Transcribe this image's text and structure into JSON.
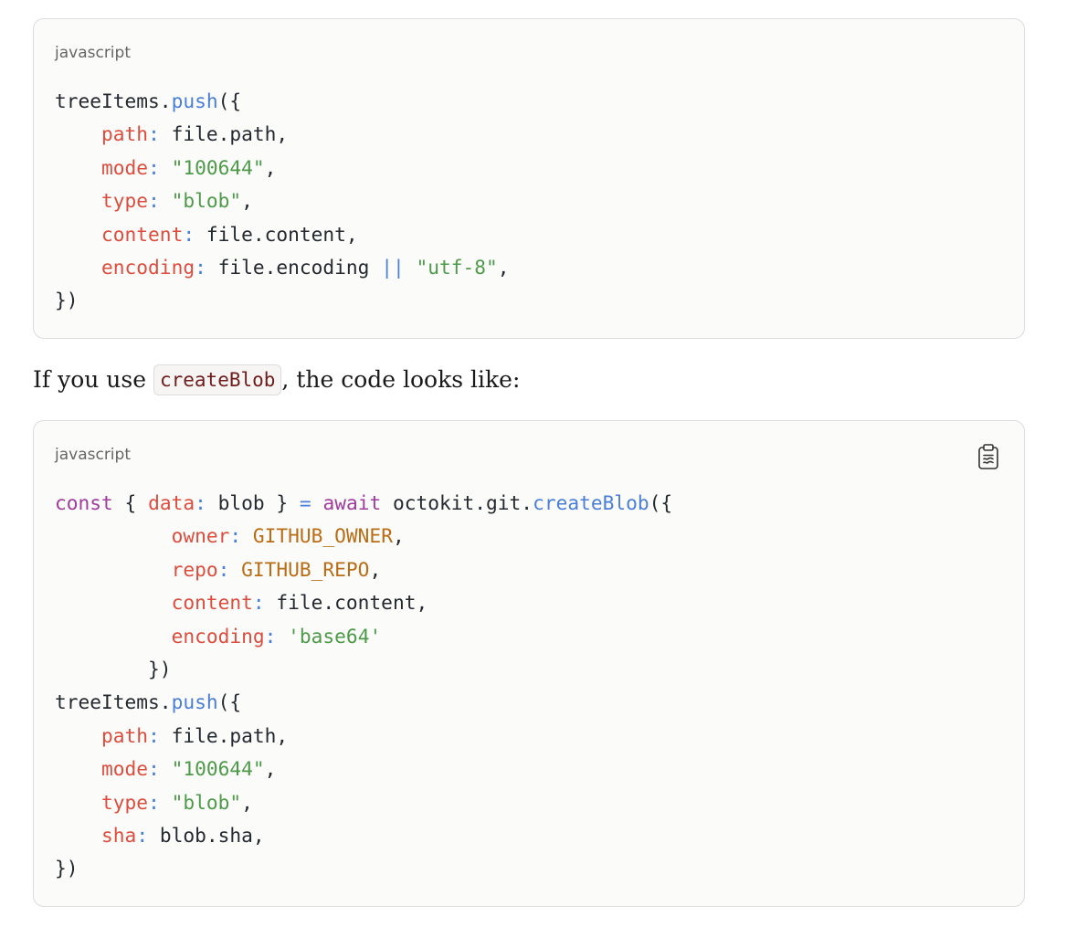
{
  "blocks": [
    {
      "language": "javascript",
      "lines": [
        [
          {
            "t": "treeItems.",
            "c": "plain"
          },
          {
            "t": "push",
            "c": "fn"
          },
          {
            "t": "({",
            "c": "plain"
          }
        ],
        [
          {
            "t": "    ",
            "c": "plain"
          },
          {
            "t": "path",
            "c": "prop"
          },
          {
            "t": ":",
            "c": "op"
          },
          {
            "t": " file.path,",
            "c": "plain"
          }
        ],
        [
          {
            "t": "    ",
            "c": "plain"
          },
          {
            "t": "mode",
            "c": "prop"
          },
          {
            "t": ":",
            "c": "op"
          },
          {
            "t": " ",
            "c": "plain"
          },
          {
            "t": "\"100644\"",
            "c": "str"
          },
          {
            "t": ",",
            "c": "plain"
          }
        ],
        [
          {
            "t": "    ",
            "c": "plain"
          },
          {
            "t": "type",
            "c": "prop"
          },
          {
            "t": ":",
            "c": "op"
          },
          {
            "t": " ",
            "c": "plain"
          },
          {
            "t": "\"blob\"",
            "c": "str"
          },
          {
            "t": ",",
            "c": "plain"
          }
        ],
        [
          {
            "t": "    ",
            "c": "plain"
          },
          {
            "t": "content",
            "c": "prop"
          },
          {
            "t": ":",
            "c": "op"
          },
          {
            "t": " file.content,",
            "c": "plain"
          }
        ],
        [
          {
            "t": "    ",
            "c": "plain"
          },
          {
            "t": "encoding",
            "c": "prop"
          },
          {
            "t": ":",
            "c": "op"
          },
          {
            "t": " file.encoding ",
            "c": "plain"
          },
          {
            "t": "||",
            "c": "op"
          },
          {
            "t": " ",
            "c": "plain"
          },
          {
            "t": "\"utf-8\"",
            "c": "str"
          },
          {
            "t": ",",
            "c": "plain"
          }
        ],
        [
          {
            "t": "})",
            "c": "plain"
          }
        ]
      ]
    },
    {
      "language": "javascript",
      "copy_icon": "clipboard-icon",
      "lines": [
        [
          {
            "t": "const",
            "c": "kw"
          },
          {
            "t": " { ",
            "c": "plain"
          },
          {
            "t": "data",
            "c": "prop"
          },
          {
            "t": ":",
            "c": "op"
          },
          {
            "t": " blob } ",
            "c": "plain"
          },
          {
            "t": "=",
            "c": "op"
          },
          {
            "t": " ",
            "c": "plain"
          },
          {
            "t": "await",
            "c": "kw"
          },
          {
            "t": " octokit.git.",
            "c": "plain"
          },
          {
            "t": "createBlob",
            "c": "fn"
          },
          {
            "t": "({",
            "c": "plain"
          }
        ],
        [
          {
            "t": "          ",
            "c": "plain"
          },
          {
            "t": "owner",
            "c": "prop"
          },
          {
            "t": ":",
            "c": "op"
          },
          {
            "t": " ",
            "c": "plain"
          },
          {
            "t": "GITHUB_OWNER",
            "c": "const"
          },
          {
            "t": ",",
            "c": "plain"
          }
        ],
        [
          {
            "t": "          ",
            "c": "plain"
          },
          {
            "t": "repo",
            "c": "prop"
          },
          {
            "t": ":",
            "c": "op"
          },
          {
            "t": " ",
            "c": "plain"
          },
          {
            "t": "GITHUB_REPO",
            "c": "const"
          },
          {
            "t": ",",
            "c": "plain"
          }
        ],
        [
          {
            "t": "          ",
            "c": "plain"
          },
          {
            "t": "content",
            "c": "prop"
          },
          {
            "t": ":",
            "c": "op"
          },
          {
            "t": " file.content,",
            "c": "plain"
          }
        ],
        [
          {
            "t": "          ",
            "c": "plain"
          },
          {
            "t": "encoding",
            "c": "prop"
          },
          {
            "t": ":",
            "c": "op"
          },
          {
            "t": " ",
            "c": "plain"
          },
          {
            "t": "'base64'",
            "c": "str"
          }
        ],
        [
          {
            "t": "        })",
            "c": "plain"
          }
        ],
        [
          {
            "t": "treeItems.",
            "c": "plain"
          },
          {
            "t": "push",
            "c": "fn"
          },
          {
            "t": "({",
            "c": "plain"
          }
        ],
        [
          {
            "t": "    ",
            "c": "plain"
          },
          {
            "t": "path",
            "c": "prop"
          },
          {
            "t": ":",
            "c": "op"
          },
          {
            "t": " file.path,",
            "c": "plain"
          }
        ],
        [
          {
            "t": "    ",
            "c": "plain"
          },
          {
            "t": "mode",
            "c": "prop"
          },
          {
            "t": ":",
            "c": "op"
          },
          {
            "t": " ",
            "c": "plain"
          },
          {
            "t": "\"100644\"",
            "c": "str"
          },
          {
            "t": ",",
            "c": "plain"
          }
        ],
        [
          {
            "t": "    ",
            "c": "plain"
          },
          {
            "t": "type",
            "c": "prop"
          },
          {
            "t": ":",
            "c": "op"
          },
          {
            "t": " ",
            "c": "plain"
          },
          {
            "t": "\"blob\"",
            "c": "str"
          },
          {
            "t": ",",
            "c": "plain"
          }
        ],
        [
          {
            "t": "    ",
            "c": "plain"
          },
          {
            "t": "sha",
            "c": "prop"
          },
          {
            "t": ":",
            "c": "op"
          },
          {
            "t": " blob.sha,",
            "c": "plain"
          }
        ],
        [
          {
            "t": "})",
            "c": "plain"
          }
        ]
      ]
    }
  ],
  "prose": {
    "before": "If you use ",
    "inline_code": "createBlob",
    "after": ", the code looks like:"
  },
  "colors": {
    "property": "#dc4d3e",
    "string": "#4d9a48",
    "keyword": "#a13b9e",
    "function": "#4a7fd8",
    "constant": "#b96d16",
    "operator": "#4a7fd8",
    "text": "#24292f"
  }
}
